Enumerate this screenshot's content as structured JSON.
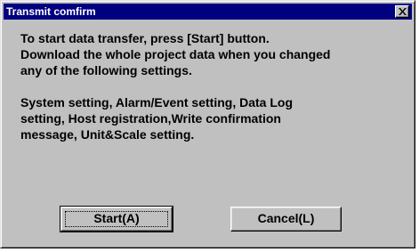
{
  "dialog": {
    "title": "Transmit comfirm",
    "close_icon": "close-x-icon",
    "message_paragraph_1": "To start data transfer, press [Start] button.\nDownload the whole project data when you changed\nany of the following settings.",
    "message_paragraph_2": "System setting, Alarm/Event setting, Data Log\nsetting, Host registration,Write confirmation\nmessage, Unit&Scale setting.",
    "buttons": {
      "start_label": "Start(A)",
      "cancel_label": "Cancel(L)"
    }
  }
}
